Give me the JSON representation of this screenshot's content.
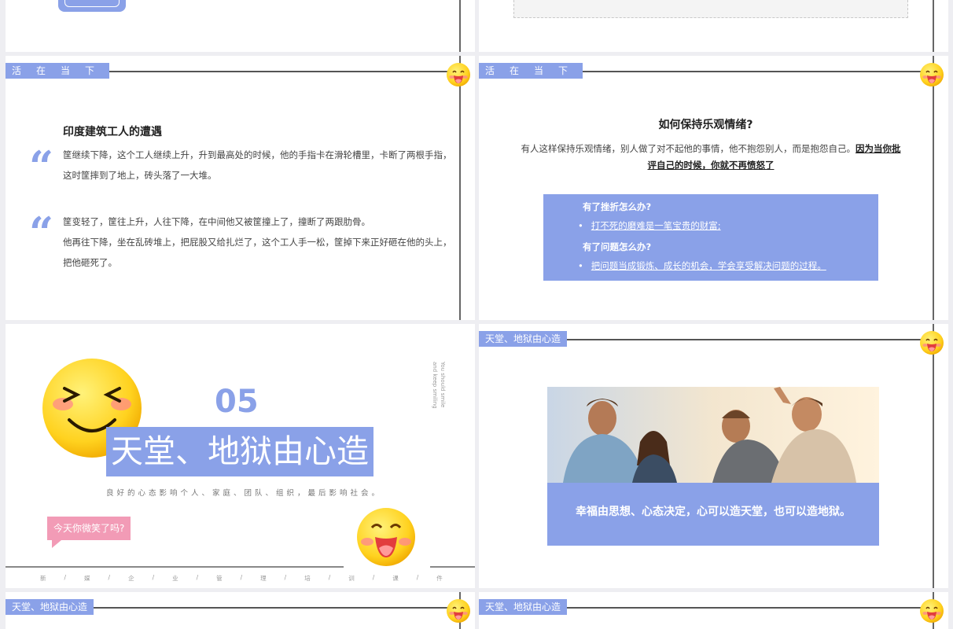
{
  "slide_a": {},
  "slide_c": {
    "tag": "活在当下",
    "title": "印度建筑工人的遭遇",
    "quote_mark": "“",
    "para1_line1": "筐继续下降，这个工人继续上升，升到最高处的时候，他的手指卡在滑轮槽里，卡断了两根手指，",
    "para1_line2": "这时筐摔到了地上，砖头落了一大堆。",
    "para2_line1": "筐变轻了，筐往上升，人往下降，在中间他又被筐撞上了，撞断了两跟肋骨。",
    "para2_line2": "他再往下降，坐在乱砖堆上，把屁股又给扎烂了，这个工人手一松，筐掉下来正好砸在他的头上，",
    "para2_line3": "把他砸死了。"
  },
  "slide_d": {
    "tag": "活在当下",
    "title": "如何保持乐观情绪?",
    "intro_plain": "有人这样保持乐观情绪，别人做了对不起他的事情，他不抱怨别人，而是抱怨自己。",
    "intro_bold_1": "因为当你批",
    "intro_bold_2": "评自己的时候，你就不再愤怒了",
    "box": {
      "q1": "有了挫折怎么办?",
      "a1": "打不死的磨难是一笔宝贵的财富;",
      "q2": "有了问题怎么办?",
      "a2": "把问题当成锻炼、成长的机会，学会享受解决问题的过程。",
      "bullet": "•"
    }
  },
  "slide_e": {
    "number": "05",
    "title": "天堂、地狱由心造",
    "subtitle": "良好的心态影响个人、家庭、团队、组织，最后影响社会。",
    "vertical_text": "You should smile and keep smiling",
    "bubble": "今天你微笑了吗?",
    "footer": [
      "新",
      "/",
      "媒",
      "/",
      "企",
      "/",
      "业",
      "/",
      "管",
      "/",
      "理",
      "/",
      "培",
      "/",
      "训",
      "/",
      "课",
      "/",
      "件"
    ]
  },
  "slide_f": {
    "tag": "天堂、地狱由心造",
    "caption": "幸福由思想、心态决定，心可以造天堂，也可以造地狱。"
  },
  "slide_g": {
    "tag": "天堂、地狱由心造"
  },
  "slide_h": {
    "tag": "天堂、地狱由心造"
  },
  "colors": {
    "accent": "#8aa1e8",
    "pink": "#f29bb6",
    "emoji_yellow": "#ffd83a"
  }
}
